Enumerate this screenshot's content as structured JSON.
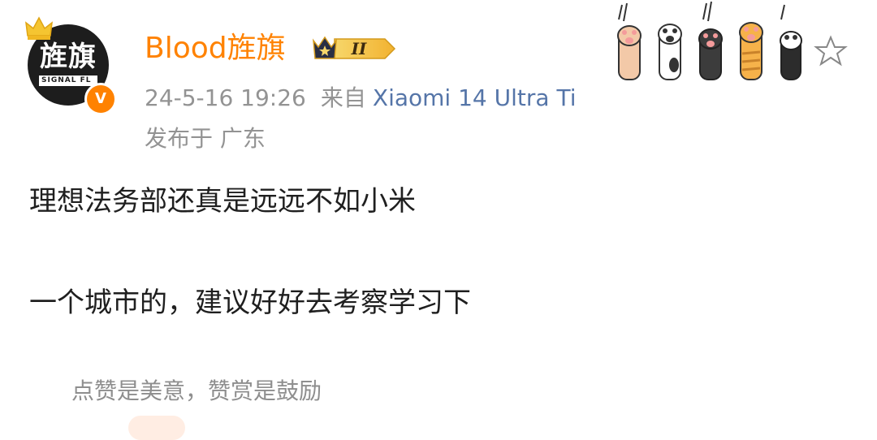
{
  "author": {
    "name": "Blood旌旗",
    "avatar_glyphs": "旌旗",
    "avatar_band": "SIGNAL FL",
    "verified_mark": "V",
    "rank_badge": "II",
    "name_color": "#ff8200",
    "verified_color": "#ff8200"
  },
  "meta": {
    "timestamp": "24-5-16 19:26",
    "source_prefix": "来自",
    "device": "Xiaomi 14 Ultra Ti",
    "location": "发布于 广东"
  },
  "post": {
    "lines": [
      "理想法务部还真是远远不如小米",
      "一个城市的，建议好好去考察学习下"
    ]
  },
  "reward": {
    "caption": "点赞是美意，赞赏是鼓励"
  },
  "icons": {
    "crown": "crown-icon",
    "verified": "verified-icon",
    "rank": "rank-badge-icon",
    "paws": "cat-paws-decoration",
    "favorite": "star-outline-icon"
  }
}
